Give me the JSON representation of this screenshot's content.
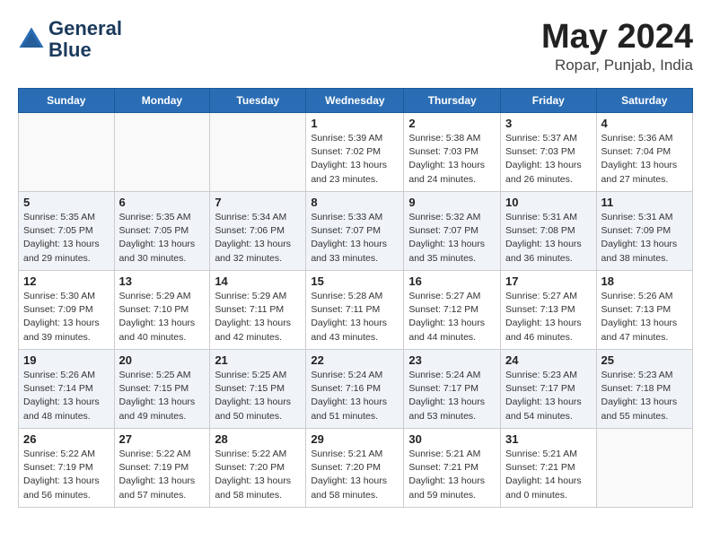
{
  "header": {
    "logo_line1": "General",
    "logo_line2": "Blue",
    "month": "May 2024",
    "location": "Ropar, Punjab, India"
  },
  "weekdays": [
    "Sunday",
    "Monday",
    "Tuesday",
    "Wednesday",
    "Thursday",
    "Friday",
    "Saturday"
  ],
  "weeks": [
    [
      {
        "day": "",
        "info": ""
      },
      {
        "day": "",
        "info": ""
      },
      {
        "day": "",
        "info": ""
      },
      {
        "day": "1",
        "info": "Sunrise: 5:39 AM\nSunset: 7:02 PM\nDaylight: 13 hours\nand 23 minutes."
      },
      {
        "day": "2",
        "info": "Sunrise: 5:38 AM\nSunset: 7:03 PM\nDaylight: 13 hours\nand 24 minutes."
      },
      {
        "day": "3",
        "info": "Sunrise: 5:37 AM\nSunset: 7:03 PM\nDaylight: 13 hours\nand 26 minutes."
      },
      {
        "day": "4",
        "info": "Sunrise: 5:36 AM\nSunset: 7:04 PM\nDaylight: 13 hours\nand 27 minutes."
      }
    ],
    [
      {
        "day": "5",
        "info": "Sunrise: 5:35 AM\nSunset: 7:05 PM\nDaylight: 13 hours\nand 29 minutes."
      },
      {
        "day": "6",
        "info": "Sunrise: 5:35 AM\nSunset: 7:05 PM\nDaylight: 13 hours\nand 30 minutes."
      },
      {
        "day": "7",
        "info": "Sunrise: 5:34 AM\nSunset: 7:06 PM\nDaylight: 13 hours\nand 32 minutes."
      },
      {
        "day": "8",
        "info": "Sunrise: 5:33 AM\nSunset: 7:07 PM\nDaylight: 13 hours\nand 33 minutes."
      },
      {
        "day": "9",
        "info": "Sunrise: 5:32 AM\nSunset: 7:07 PM\nDaylight: 13 hours\nand 35 minutes."
      },
      {
        "day": "10",
        "info": "Sunrise: 5:31 AM\nSunset: 7:08 PM\nDaylight: 13 hours\nand 36 minutes."
      },
      {
        "day": "11",
        "info": "Sunrise: 5:31 AM\nSunset: 7:09 PM\nDaylight: 13 hours\nand 38 minutes."
      }
    ],
    [
      {
        "day": "12",
        "info": "Sunrise: 5:30 AM\nSunset: 7:09 PM\nDaylight: 13 hours\nand 39 minutes."
      },
      {
        "day": "13",
        "info": "Sunrise: 5:29 AM\nSunset: 7:10 PM\nDaylight: 13 hours\nand 40 minutes."
      },
      {
        "day": "14",
        "info": "Sunrise: 5:29 AM\nSunset: 7:11 PM\nDaylight: 13 hours\nand 42 minutes."
      },
      {
        "day": "15",
        "info": "Sunrise: 5:28 AM\nSunset: 7:11 PM\nDaylight: 13 hours\nand 43 minutes."
      },
      {
        "day": "16",
        "info": "Sunrise: 5:27 AM\nSunset: 7:12 PM\nDaylight: 13 hours\nand 44 minutes."
      },
      {
        "day": "17",
        "info": "Sunrise: 5:27 AM\nSunset: 7:13 PM\nDaylight: 13 hours\nand 46 minutes."
      },
      {
        "day": "18",
        "info": "Sunrise: 5:26 AM\nSunset: 7:13 PM\nDaylight: 13 hours\nand 47 minutes."
      }
    ],
    [
      {
        "day": "19",
        "info": "Sunrise: 5:26 AM\nSunset: 7:14 PM\nDaylight: 13 hours\nand 48 minutes."
      },
      {
        "day": "20",
        "info": "Sunrise: 5:25 AM\nSunset: 7:15 PM\nDaylight: 13 hours\nand 49 minutes."
      },
      {
        "day": "21",
        "info": "Sunrise: 5:25 AM\nSunset: 7:15 PM\nDaylight: 13 hours\nand 50 minutes."
      },
      {
        "day": "22",
        "info": "Sunrise: 5:24 AM\nSunset: 7:16 PM\nDaylight: 13 hours\nand 51 minutes."
      },
      {
        "day": "23",
        "info": "Sunrise: 5:24 AM\nSunset: 7:17 PM\nDaylight: 13 hours\nand 53 minutes."
      },
      {
        "day": "24",
        "info": "Sunrise: 5:23 AM\nSunset: 7:17 PM\nDaylight: 13 hours\nand 54 minutes."
      },
      {
        "day": "25",
        "info": "Sunrise: 5:23 AM\nSunset: 7:18 PM\nDaylight: 13 hours\nand 55 minutes."
      }
    ],
    [
      {
        "day": "26",
        "info": "Sunrise: 5:22 AM\nSunset: 7:19 PM\nDaylight: 13 hours\nand 56 minutes."
      },
      {
        "day": "27",
        "info": "Sunrise: 5:22 AM\nSunset: 7:19 PM\nDaylight: 13 hours\nand 57 minutes."
      },
      {
        "day": "28",
        "info": "Sunrise: 5:22 AM\nSunset: 7:20 PM\nDaylight: 13 hours\nand 58 minutes."
      },
      {
        "day": "29",
        "info": "Sunrise: 5:21 AM\nSunset: 7:20 PM\nDaylight: 13 hours\nand 58 minutes."
      },
      {
        "day": "30",
        "info": "Sunrise: 5:21 AM\nSunset: 7:21 PM\nDaylight: 13 hours\nand 59 minutes."
      },
      {
        "day": "31",
        "info": "Sunrise: 5:21 AM\nSunset: 7:21 PM\nDaylight: 14 hours\nand 0 minutes."
      },
      {
        "day": "",
        "info": ""
      }
    ]
  ]
}
